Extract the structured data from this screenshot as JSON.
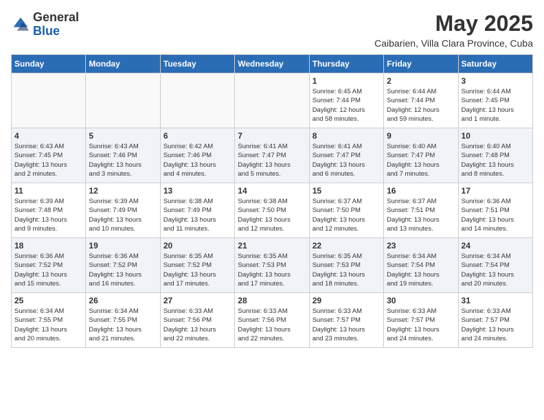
{
  "header": {
    "logo_general": "General",
    "logo_blue": "Blue",
    "month_year": "May 2025",
    "location": "Caibarien, Villa Clara Province, Cuba"
  },
  "days_of_week": [
    "Sunday",
    "Monday",
    "Tuesday",
    "Wednesday",
    "Thursday",
    "Friday",
    "Saturday"
  ],
  "weeks": [
    [
      {
        "day": "",
        "info": ""
      },
      {
        "day": "",
        "info": ""
      },
      {
        "day": "",
        "info": ""
      },
      {
        "day": "",
        "info": ""
      },
      {
        "day": "1",
        "info": "Sunrise: 6:45 AM\nSunset: 7:44 PM\nDaylight: 12 hours\nand 58 minutes."
      },
      {
        "day": "2",
        "info": "Sunrise: 6:44 AM\nSunset: 7:44 PM\nDaylight: 12 hours\nand 59 minutes."
      },
      {
        "day": "3",
        "info": "Sunrise: 6:44 AM\nSunset: 7:45 PM\nDaylight: 13 hours\nand 1 minute."
      }
    ],
    [
      {
        "day": "4",
        "info": "Sunrise: 6:43 AM\nSunset: 7:45 PM\nDaylight: 13 hours\nand 2 minutes."
      },
      {
        "day": "5",
        "info": "Sunrise: 6:43 AM\nSunset: 7:46 PM\nDaylight: 13 hours\nand 3 minutes."
      },
      {
        "day": "6",
        "info": "Sunrise: 6:42 AM\nSunset: 7:46 PM\nDaylight: 13 hours\nand 4 minutes."
      },
      {
        "day": "7",
        "info": "Sunrise: 6:41 AM\nSunset: 7:47 PM\nDaylight: 13 hours\nand 5 minutes."
      },
      {
        "day": "8",
        "info": "Sunrise: 6:41 AM\nSunset: 7:47 PM\nDaylight: 13 hours\nand 6 minutes."
      },
      {
        "day": "9",
        "info": "Sunrise: 6:40 AM\nSunset: 7:47 PM\nDaylight: 13 hours\nand 7 minutes."
      },
      {
        "day": "10",
        "info": "Sunrise: 6:40 AM\nSunset: 7:48 PM\nDaylight: 13 hours\nand 8 minutes."
      }
    ],
    [
      {
        "day": "11",
        "info": "Sunrise: 6:39 AM\nSunset: 7:48 PM\nDaylight: 13 hours\nand 9 minutes."
      },
      {
        "day": "12",
        "info": "Sunrise: 6:39 AM\nSunset: 7:49 PM\nDaylight: 13 hours\nand 10 minutes."
      },
      {
        "day": "13",
        "info": "Sunrise: 6:38 AM\nSunset: 7:49 PM\nDaylight: 13 hours\nand 11 minutes."
      },
      {
        "day": "14",
        "info": "Sunrise: 6:38 AM\nSunset: 7:50 PM\nDaylight: 13 hours\nand 12 minutes."
      },
      {
        "day": "15",
        "info": "Sunrise: 6:37 AM\nSunset: 7:50 PM\nDaylight: 13 hours\nand 12 minutes."
      },
      {
        "day": "16",
        "info": "Sunrise: 6:37 AM\nSunset: 7:51 PM\nDaylight: 13 hours\nand 13 minutes."
      },
      {
        "day": "17",
        "info": "Sunrise: 6:36 AM\nSunset: 7:51 PM\nDaylight: 13 hours\nand 14 minutes."
      }
    ],
    [
      {
        "day": "18",
        "info": "Sunrise: 6:36 AM\nSunset: 7:52 PM\nDaylight: 13 hours\nand 15 minutes."
      },
      {
        "day": "19",
        "info": "Sunrise: 6:36 AM\nSunset: 7:52 PM\nDaylight: 13 hours\nand 16 minutes."
      },
      {
        "day": "20",
        "info": "Sunrise: 6:35 AM\nSunset: 7:52 PM\nDaylight: 13 hours\nand 17 minutes."
      },
      {
        "day": "21",
        "info": "Sunrise: 6:35 AM\nSunset: 7:53 PM\nDaylight: 13 hours\nand 17 minutes."
      },
      {
        "day": "22",
        "info": "Sunrise: 6:35 AM\nSunset: 7:53 PM\nDaylight: 13 hours\nand 18 minutes."
      },
      {
        "day": "23",
        "info": "Sunrise: 6:34 AM\nSunset: 7:54 PM\nDaylight: 13 hours\nand 19 minutes."
      },
      {
        "day": "24",
        "info": "Sunrise: 6:34 AM\nSunset: 7:54 PM\nDaylight: 13 hours\nand 20 minutes."
      }
    ],
    [
      {
        "day": "25",
        "info": "Sunrise: 6:34 AM\nSunset: 7:55 PM\nDaylight: 13 hours\nand 20 minutes."
      },
      {
        "day": "26",
        "info": "Sunrise: 6:34 AM\nSunset: 7:55 PM\nDaylight: 13 hours\nand 21 minutes."
      },
      {
        "day": "27",
        "info": "Sunrise: 6:33 AM\nSunset: 7:56 PM\nDaylight: 13 hours\nand 22 minutes."
      },
      {
        "day": "28",
        "info": "Sunrise: 6:33 AM\nSunset: 7:56 PM\nDaylight: 13 hours\nand 22 minutes."
      },
      {
        "day": "29",
        "info": "Sunrise: 6:33 AM\nSunset: 7:57 PM\nDaylight: 13 hours\nand 23 minutes."
      },
      {
        "day": "30",
        "info": "Sunrise: 6:33 AM\nSunset: 7:57 PM\nDaylight: 13 hours\nand 24 minutes."
      },
      {
        "day": "31",
        "info": "Sunrise: 6:33 AM\nSunset: 7:57 PM\nDaylight: 13 hours\nand 24 minutes."
      }
    ]
  ]
}
